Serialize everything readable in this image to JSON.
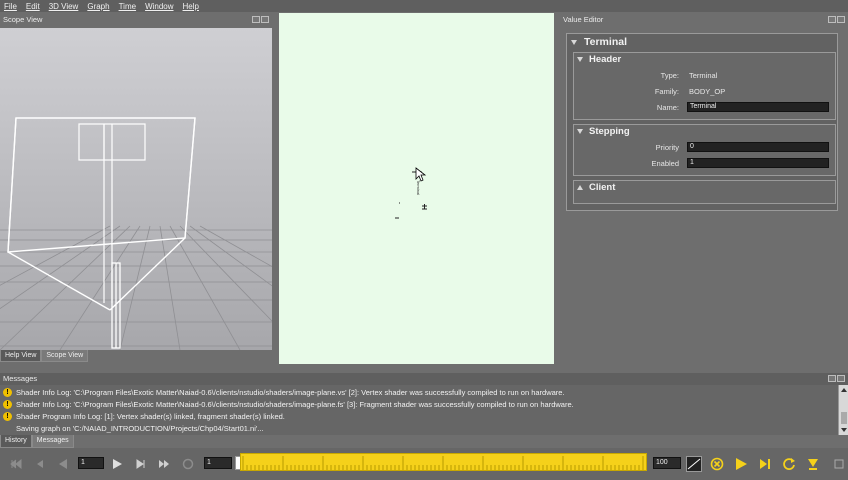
{
  "menu": [
    "File",
    "Edit",
    "3D View",
    "Graph",
    "Time",
    "Window",
    "Help"
  ],
  "scope_panel": {
    "title": "Scope View",
    "tabs": [
      "Help View",
      "Scope View"
    ]
  },
  "graph": {
    "node_label": "Terminal"
  },
  "value_editor": {
    "panel_title": "Value Editor",
    "node_title": "Terminal",
    "header": {
      "title": "Header",
      "type_label": "Type:",
      "type_value": "Terminal",
      "family_label": "Family:",
      "family_value": "BODY_OP",
      "name_label": "Name:",
      "name_value": "Terminal"
    },
    "stepping": {
      "title": "Stepping",
      "priority_label": "Priority",
      "priority_value": "0",
      "enabled_label": "Enabled",
      "enabled_value": "1"
    },
    "client": {
      "title": "Client"
    }
  },
  "messages": {
    "title": "Messages",
    "rows": [
      {
        "icon": "warning-icon",
        "text": "Shader Info Log: 'C:\\Program Files\\Exotic Matter\\Naiad-0.6\\/clients/nstudio/shaders/image-plane.vs' [2]: Vertex shader was successfully compiled to run on hardware."
      },
      {
        "icon": "warning-icon",
        "text": "Shader Info Log: 'C:\\Program Files\\Exotic Matter\\Naiad-0.6\\/clients/nstudio/shaders/image-plane.fs' [3]: Fragment shader was successfully compiled to run on hardware."
      },
      {
        "icon": "warning-icon",
        "text": "Shader Program Info Log: [1]: Vertex shader(s) linked, fragment shader(s) linked."
      },
      {
        "icon": "",
        "text": "Saving graph on 'C:/NAIAD_INTRODUCTION/Projects/Chp04/Start01.ni'..."
      }
    ],
    "tabs": [
      "History",
      "Messages"
    ]
  },
  "timeline": {
    "step_value": "1",
    "current_frame": "1",
    "end_frame": "100",
    "slider_position": 0.0
  },
  "colors": {
    "graph_background": "#e9fbe9",
    "timeline_slider": "#f5d11a",
    "warning": "#f0c000",
    "panel": "#6e6e6e"
  }
}
